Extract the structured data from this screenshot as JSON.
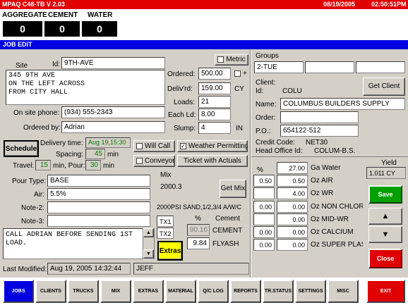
{
  "app": {
    "title": "MPAQ C48-TB V 2.03",
    "date": "08/19/2005",
    "time": "02:50:51PM"
  },
  "counters": [
    {
      "label": "AGGREGATE",
      "value": "0"
    },
    {
      "label": "CEMENT",
      "value": "0"
    },
    {
      "label": "WATER",
      "value": "0"
    }
  ],
  "section": "JOB EDIT",
  "job": {
    "id_label": "Id:",
    "id": "9TH-AVE",
    "site_label": "Site",
    "site_lines": [
      "345 9TH AVE",
      "ON THE LEFT ACROSS",
      "FROM CITY HALL"
    ],
    "phone_label": "On site phone:",
    "phone": "(934) 555-2343",
    "ordered_by_label": "Ordered by:",
    "ordered_by": "Adrian",
    "metric_label": "Metric",
    "plus_label": "+",
    "ordered_label": "Ordered:",
    "ordered": "500.00",
    "delivered_label": "Deliv'rd:",
    "delivered": "159.00",
    "unit": "CY",
    "loads_label": "Loads:",
    "loads": "21",
    "each_ld_label": "Each Ld:",
    "each_ld": "8.00",
    "slump_label": "Slump:",
    "slump": "4",
    "slump_unit": "IN",
    "schedule_button": "Schedule",
    "delivery_time_label": "Delivery time:",
    "delivery_time": "Aug 19,15:30",
    "spacing_label": "Spacing:",
    "spacing": "45",
    "spacing_unit": "min",
    "travel_label": "Travel:",
    "travel": "15",
    "travel_mid": "min, Pour:",
    "pour": "30",
    "pour_unit": "min",
    "will_call": "Will Call",
    "weather": "Weather Permitting",
    "conveyor": "Conveyor",
    "ticket_actuals": "Ticket with Actuals",
    "pour_type_label": "Pour Type:",
    "pour_type": "BASE",
    "air_label": "Air:",
    "air": "5.5%",
    "note2_label": "Note-2:",
    "note2": "",
    "note3_label": "Note-3:",
    "note3": "",
    "note_lines": [
      "CALL ADRIAN BEFORE SENDING 1ST",
      "LOAD."
    ],
    "last_modified_label": "Last Modified:",
    "last_modified": "Aug 19, 2005 14:32:44",
    "modified_by": "JEFF"
  },
  "mix": {
    "label": "Mix",
    "code": "2000.3",
    "get_mix": "Get Mix",
    "description": "2000PSI SAND,1/2,3/4 A/W/C",
    "pct_header": "%",
    "cement_header": "Cement",
    "tx": [
      "TX1",
      "TX2"
    ],
    "rows": [
      {
        "pct": "90.16",
        "name": "CEMENT"
      },
      {
        "pct": "9.84",
        "name": "FLYASH"
      }
    ],
    "extras": "Extras"
  },
  "groups": {
    "label": "Groups",
    "values": [
      "2-TUE",
      "",
      "",
      ""
    ]
  },
  "client": {
    "client_label": "Client:",
    "id_label": "Id:",
    "id": "COLU",
    "get_client": "Get Client",
    "name_label": "Name:",
    "name": "COLUMBUS BUILDERS SUPPLY",
    "order_label": "Order:",
    "order": "",
    "po_label": "P.O.:",
    "po": "654122-512",
    "credit_label": "Credit Code:",
    "credit": "NET30",
    "head_label": "Head Office Id:",
    "head": "COLUM-B.S."
  },
  "admix": {
    "pct_header": "%",
    "rows": [
      {
        "a": "",
        "b": "27.00",
        "name": "Ga Water"
      },
      {
        "a": "0.50",
        "b": "0.50",
        "name": "Oz AIR"
      },
      {
        "a": "",
        "b": "4.00",
        "name": "Oz WR"
      },
      {
        "a": "0.00",
        "b": "0.00",
        "name": "Oz NON CHLOR"
      },
      {
        "a": "",
        "b": "0.00",
        "name": "Oz MID-WR"
      },
      {
        "a": "0.00",
        "b": "0.00",
        "name": "Oz CALCIUM"
      },
      {
        "a": "0.00",
        "b": "0.00",
        "name": "Oz SUPER PLAS"
      }
    ]
  },
  "yield": {
    "label": "Yield",
    "value": "1.011 CY"
  },
  "actions": {
    "save": "Save",
    "close": "Close"
  },
  "nav": [
    "JOBS",
    "CLIENTS",
    "TRUCKS",
    "MIX",
    "EXTRAS",
    "MATERIAL",
    "Q/C LOG",
    "REPORTS",
    "TR.STATUS",
    "SETTINGS",
    "MISC",
    "EXIT"
  ]
}
